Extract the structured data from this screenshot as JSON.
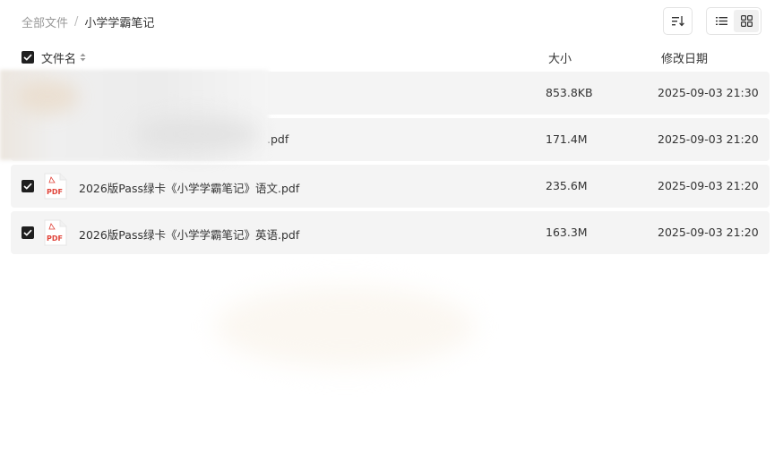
{
  "breadcrumb": {
    "root": "全部文件",
    "separator": "/",
    "current": "小学学霸笔记"
  },
  "toolbar": {
    "sort_icon": "sort-icon",
    "list_view_icon": "list-view-icon",
    "grid_view_icon": "grid-view-icon",
    "active_view": "list"
  },
  "columns": {
    "name": "文件名",
    "size": "大小",
    "date": "修改日期"
  },
  "files": [
    {
      "name": "",
      "size": "853.8KB",
      "date": "2025-09-03 21:30",
      "icon": "image-file-icon",
      "checked": false
    },
    {
      "name": ".pdf",
      "size": "171.4M",
      "date": "2025-09-03 21:20",
      "icon": "pdf-file-icon",
      "checked": false
    },
    {
      "name": "2026版Pass绿卡《小学学霸笔记》语文.pdf",
      "size": "235.6M",
      "date": "2025-09-03 21:20",
      "icon": "pdf-file-icon",
      "checked": true
    },
    {
      "name": "2026版Pass绿卡《小学学霸笔记》英语.pdf",
      "size": "163.3M",
      "date": "2025-09-03 21:20",
      "icon": "pdf-file-icon",
      "checked": true
    }
  ],
  "pdf_badge": "PDF",
  "colors": {
    "row_bg": "#f4f4f4",
    "checkbox": "#1f1f1f",
    "pdf_red": "#e0443a"
  }
}
